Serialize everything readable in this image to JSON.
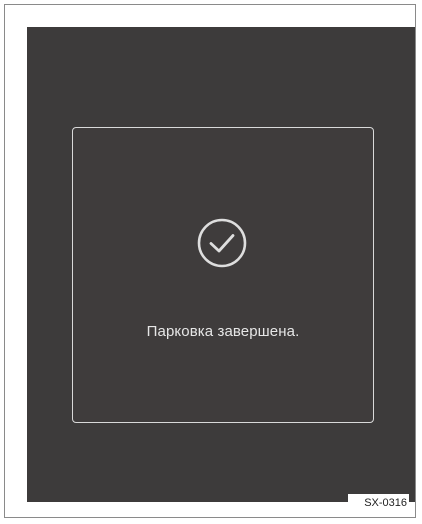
{
  "dialog": {
    "icon": "checkmark-circle-icon",
    "message": "Парковка завершена."
  },
  "figure": {
    "code": "SX-0316"
  },
  "colors": {
    "screen_background": "#3d3b3b",
    "dialog_border": "#d9d9d9",
    "text": "#e6e6e6"
  }
}
